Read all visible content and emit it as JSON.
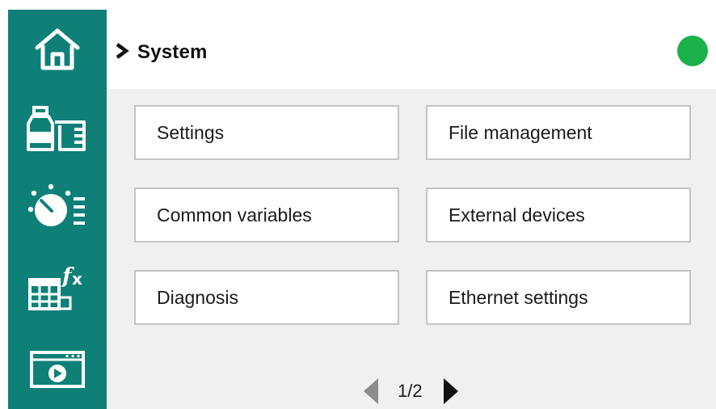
{
  "header": {
    "title": "System",
    "breadcrumb_icon": "chevron-right-icon",
    "status_color": "#1cb24b"
  },
  "sidebar": {
    "background": "#0f8078",
    "items": [
      {
        "name": "home",
        "icon": "home-icon"
      },
      {
        "name": "bottle-and-beaker",
        "icon": "bottle-beaker-icon"
      },
      {
        "name": "timer-list",
        "icon": "timer-list-icon"
      },
      {
        "name": "table-function",
        "icon": "table-fx-icon"
      },
      {
        "name": "video-window",
        "icon": "video-window-icon"
      }
    ]
  },
  "menu": {
    "settings": "Settings",
    "file_management": "File management",
    "common_variables": "Common variables",
    "external_devices": "External devices",
    "diagnosis": "Diagnosis",
    "ethernet_settings": "Ethernet settings"
  },
  "pager": {
    "label": "1/2",
    "prev_icon": "arrow-left-icon",
    "next_icon": "arrow-right-icon"
  }
}
